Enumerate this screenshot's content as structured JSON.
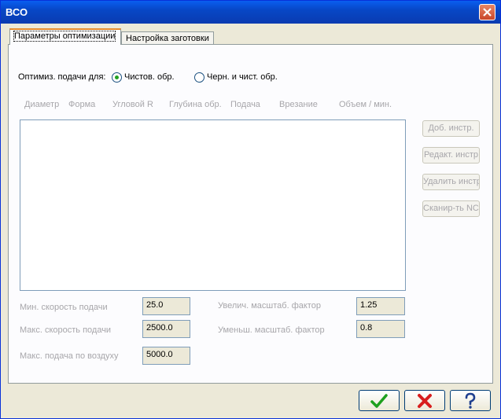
{
  "window": {
    "title": "ВСО"
  },
  "tabs": [
    {
      "label": "Параметры оптимизации",
      "active": true
    },
    {
      "label": "Настройка заготовки",
      "active": false
    }
  ],
  "optimize": {
    "label": "Оптимиз. подачи для:",
    "options": [
      {
        "label": "Чистов. обр.",
        "selected": true
      },
      {
        "label": "Черн. и чист. обр.",
        "selected": false
      }
    ]
  },
  "table": {
    "columns": [
      "Диаметр",
      "Форма",
      "Угловой R",
      "Глубина обр.",
      "Подача",
      "Врезание",
      "Объем / мин."
    ]
  },
  "side_buttons": {
    "add": "Доб. инстр.",
    "edit": "Редакт. инстр",
    "delete": "Удалить инстр",
    "scan": "Сканир-ть NCI"
  },
  "fields": {
    "min_feed": {
      "label": "Мин. скорость подачи",
      "value": "25.0"
    },
    "max_feed": {
      "label": "Макс. скорость подачи",
      "value": "2500.0"
    },
    "max_air_feed": {
      "label": "Макс. подача по воздуху",
      "value": "5000.0"
    },
    "inc_scale": {
      "label": "Увелич. масштаб. фактор",
      "value": "1.25"
    },
    "dec_scale": {
      "label": "Уменьш. масштаб. фактор",
      "value": "0.8"
    }
  },
  "colors": {
    "titlebar": "#0a5ef0",
    "ok": "#1ea01e",
    "cancel": "#d81e1e",
    "help": "#1f3f8f"
  }
}
